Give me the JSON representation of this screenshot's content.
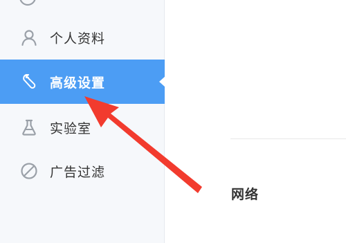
{
  "sidebar": {
    "items": [
      {
        "label": "个人资料",
        "icon": "user-icon"
      },
      {
        "label": "高级设置",
        "icon": "wrench-icon",
        "active": true
      },
      {
        "label": "实验室",
        "icon": "flask-icon"
      },
      {
        "label": "广告过滤",
        "icon": "block-icon"
      }
    ]
  },
  "main": {
    "section_title": "网络"
  },
  "colors": {
    "active_bg": "#4c9df4",
    "sidebar_bg": "#f6f8fb",
    "arrow": "#f23b2e",
    "icon_gray": "#9aa0a8"
  }
}
